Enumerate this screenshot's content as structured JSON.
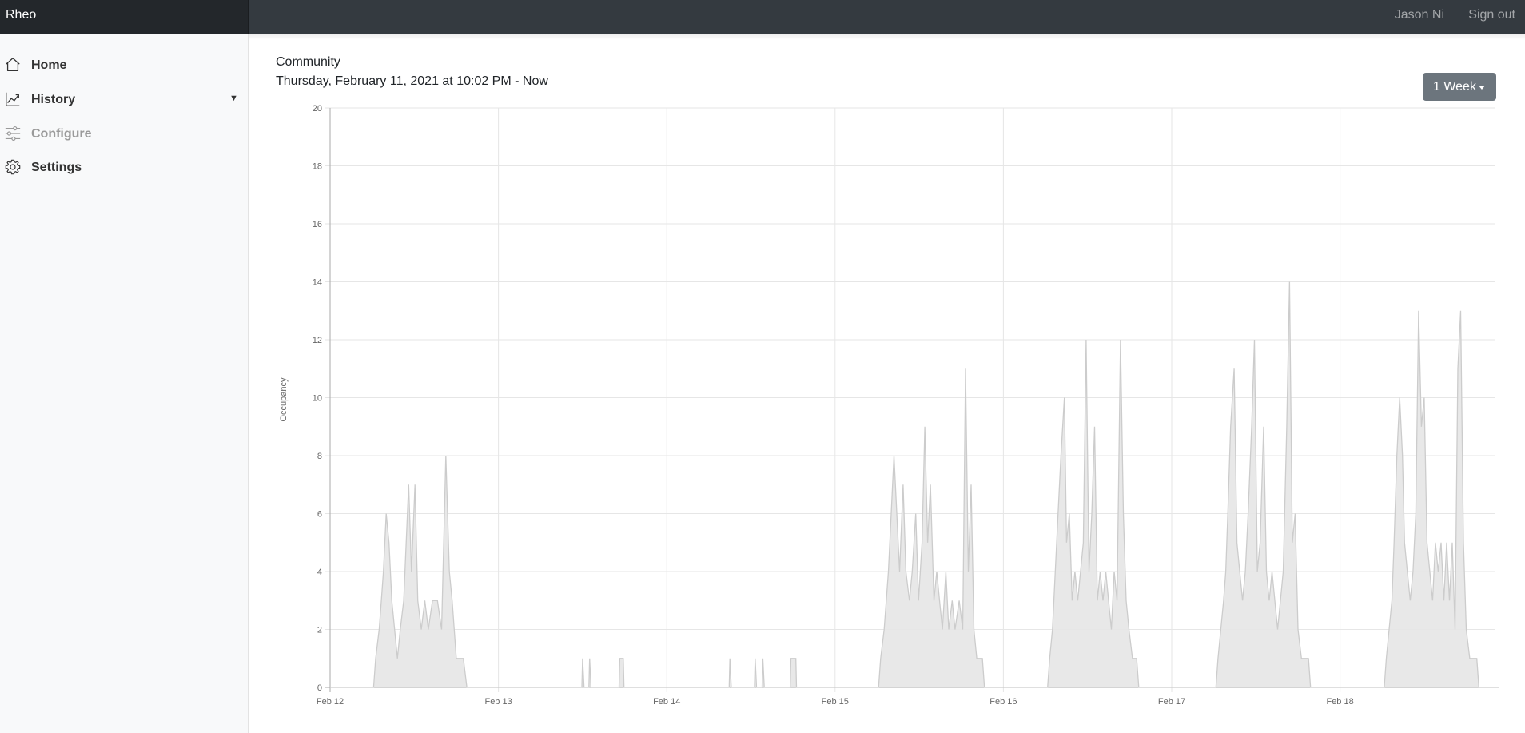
{
  "header": {
    "brand": "Rheo",
    "user_name": "Jason Ni",
    "sign_out": "Sign out"
  },
  "sidebar": {
    "items": [
      {
        "label": "Home",
        "icon": "home-icon",
        "enabled": true
      },
      {
        "label": "History",
        "icon": "chart-line-icon",
        "enabled": true,
        "has_dropdown": true
      },
      {
        "label": "Configure",
        "icon": "sliders-icon",
        "enabled": false
      },
      {
        "label": "Settings",
        "icon": "gear-icon",
        "enabled": true
      }
    ]
  },
  "main": {
    "title": "Community",
    "range_label": "Thursday, February 11, 2021 at 10:02 PM - Now",
    "range_button": "1 Week"
  },
  "colors": {
    "topbar": "#343a40",
    "brand_bg": "#23272b",
    "sidebar_bg": "#f8f9fa",
    "button": "#6c757d",
    "area_fill": "#e6e6e6",
    "area_line": "#cccccc"
  },
  "chart_data": {
    "type": "area",
    "title": "",
    "xlabel": "",
    "ylabel": "Occupancy",
    "ylim": [
      0,
      20
    ],
    "y_ticks": [
      "0",
      "2",
      "4",
      "6",
      "8",
      "10",
      "12",
      "14",
      "16",
      "18",
      "20"
    ],
    "x_ticks": [
      "Feb 12",
      "Feb 13",
      "Feb 14",
      "Feb 15",
      "Feb 16",
      "Feb 17",
      "Feb 18"
    ],
    "x_unit": "hours since Feb 12 00:00",
    "xlim": [
      0,
      167.5
    ],
    "grid": true,
    "legend": "none",
    "series": [
      {
        "points": [
          [
            0,
            0
          ],
          [
            6.2,
            0
          ],
          [
            6.5,
            1
          ],
          [
            7,
            2
          ],
          [
            7.3,
            3
          ],
          [
            7.6,
            4
          ],
          [
            8,
            6
          ],
          [
            8.4,
            5
          ],
          [
            8.8,
            3
          ],
          [
            9.2,
            2
          ],
          [
            9.6,
            1
          ],
          [
            10,
            2
          ],
          [
            10.5,
            3
          ],
          [
            11.2,
            7
          ],
          [
            11.6,
            4
          ],
          [
            12.1,
            7
          ],
          [
            12.5,
            3
          ],
          [
            13,
            2
          ],
          [
            13.5,
            3
          ],
          [
            14,
            2
          ],
          [
            14.6,
            3
          ],
          [
            15.3,
            3
          ],
          [
            15.9,
            2
          ],
          [
            16.5,
            8
          ],
          [
            17,
            4
          ],
          [
            17.4,
            3
          ],
          [
            18,
            1
          ],
          [
            19,
            1
          ],
          [
            19.5,
            0
          ],
          [
            35.9,
            0
          ],
          [
            36,
            1
          ],
          [
            36.2,
            0
          ],
          [
            36.9,
            0
          ],
          [
            37,
            1
          ],
          [
            37.2,
            0
          ],
          [
            41.2,
            0
          ],
          [
            41.3,
            1
          ],
          [
            41.8,
            1
          ],
          [
            41.9,
            0
          ],
          [
            56.9,
            0
          ],
          [
            57,
            1
          ],
          [
            57.2,
            0
          ],
          [
            60.5,
            0
          ],
          [
            60.6,
            1
          ],
          [
            60.8,
            0
          ],
          [
            61.6,
            0
          ],
          [
            61.7,
            1
          ],
          [
            61.9,
            0
          ],
          [
            65.6,
            0
          ],
          [
            65.7,
            1
          ],
          [
            66.4,
            1
          ],
          [
            66.5,
            0
          ],
          [
            78.2,
            0
          ],
          [
            78.5,
            1
          ],
          [
            79,
            2
          ],
          [
            79.6,
            4
          ],
          [
            80,
            6
          ],
          [
            80.4,
            8
          ],
          [
            80.8,
            6
          ],
          [
            81.2,
            4
          ],
          [
            81.7,
            7
          ],
          [
            82.1,
            4
          ],
          [
            82.6,
            3
          ],
          [
            83,
            4
          ],
          [
            83.5,
            6
          ],
          [
            83.9,
            3
          ],
          [
            84.4,
            5
          ],
          [
            84.8,
            9
          ],
          [
            85.2,
            5
          ],
          [
            85.6,
            7
          ],
          [
            86.1,
            3
          ],
          [
            86.5,
            4
          ],
          [
            86.9,
            3
          ],
          [
            87.3,
            2
          ],
          [
            87.8,
            4
          ],
          [
            88.2,
            2
          ],
          [
            88.7,
            3
          ],
          [
            89.1,
            2
          ],
          [
            89.7,
            3
          ],
          [
            90.2,
            2
          ],
          [
            90.6,
            11
          ],
          [
            91,
            4
          ],
          [
            91.4,
            7
          ],
          [
            91.8,
            2
          ],
          [
            92.2,
            1
          ],
          [
            93,
            1
          ],
          [
            93.3,
            0
          ],
          [
            102.3,
            0
          ],
          [
            102.6,
            1
          ],
          [
            103,
            2
          ],
          [
            103.4,
            4
          ],
          [
            103.8,
            6
          ],
          [
            104.2,
            8
          ],
          [
            104.7,
            10
          ],
          [
            105,
            5
          ],
          [
            105.4,
            6
          ],
          [
            105.8,
            3
          ],
          [
            106.2,
            4
          ],
          [
            106.6,
            3
          ],
          [
            107,
            4
          ],
          [
            107.4,
            5
          ],
          [
            107.8,
            12
          ],
          [
            108.2,
            4
          ],
          [
            108.6,
            6
          ],
          [
            109,
            9
          ],
          [
            109.4,
            3
          ],
          [
            109.8,
            4
          ],
          [
            110.2,
            3
          ],
          [
            110.6,
            4
          ],
          [
            111,
            3
          ],
          [
            111.4,
            2
          ],
          [
            111.8,
            4
          ],
          [
            112.2,
            3
          ],
          [
            112.7,
            12
          ],
          [
            113.1,
            6
          ],
          [
            113.5,
            3
          ],
          [
            113.9,
            2
          ],
          [
            114.4,
            1
          ],
          [
            115,
            1
          ],
          [
            115.3,
            0
          ],
          [
            126.3,
            0
          ],
          [
            126.6,
            1
          ],
          [
            127,
            2
          ],
          [
            127.4,
            3
          ],
          [
            127.7,
            4
          ],
          [
            128,
            6
          ],
          [
            128.4,
            9
          ],
          [
            128.9,
            11
          ],
          [
            129.3,
            5
          ],
          [
            129.7,
            4
          ],
          [
            130.1,
            3
          ],
          [
            130.5,
            4
          ],
          [
            130.9,
            6
          ],
          [
            131.4,
            9
          ],
          [
            131.8,
            12
          ],
          [
            132.2,
            4
          ],
          [
            132.6,
            5
          ],
          [
            133.1,
            9
          ],
          [
            133.5,
            4
          ],
          [
            133.9,
            3
          ],
          [
            134.3,
            4
          ],
          [
            134.7,
            3
          ],
          [
            135.1,
            2
          ],
          [
            135.5,
            3
          ],
          [
            135.9,
            4
          ],
          [
            136.4,
            9
          ],
          [
            136.8,
            14
          ],
          [
            137.2,
            5
          ],
          [
            137.6,
            6
          ],
          [
            138,
            2
          ],
          [
            138.5,
            1
          ],
          [
            139.5,
            1
          ],
          [
            139.8,
            0
          ],
          [
            150.3,
            0
          ],
          [
            150.6,
            1
          ],
          [
            151,
            2
          ],
          [
            151.4,
            3
          ],
          [
            151.7,
            5
          ],
          [
            152.1,
            8
          ],
          [
            152.5,
            10
          ],
          [
            152.9,
            8
          ],
          [
            153.2,
            5
          ],
          [
            153.6,
            4
          ],
          [
            154,
            3
          ],
          [
            154.4,
            4
          ],
          [
            154.8,
            6
          ],
          [
            155.2,
            13
          ],
          [
            155.6,
            9
          ],
          [
            156,
            10
          ],
          [
            156.4,
            5
          ],
          [
            156.8,
            4
          ],
          [
            157.2,
            3
          ],
          [
            157.6,
            5
          ],
          [
            158,
            4
          ],
          [
            158.4,
            5
          ],
          [
            158.8,
            3
          ],
          [
            159.2,
            5
          ],
          [
            159.6,
            3
          ],
          [
            160,
            5
          ],
          [
            160.4,
            2
          ],
          [
            160.8,
            11
          ],
          [
            161.2,
            13
          ],
          [
            161.6,
            5
          ],
          [
            162,
            2
          ],
          [
            162.5,
            1
          ],
          [
            163.5,
            1
          ],
          [
            163.8,
            0
          ],
          [
            167.5,
            0
          ]
        ]
      }
    ]
  }
}
